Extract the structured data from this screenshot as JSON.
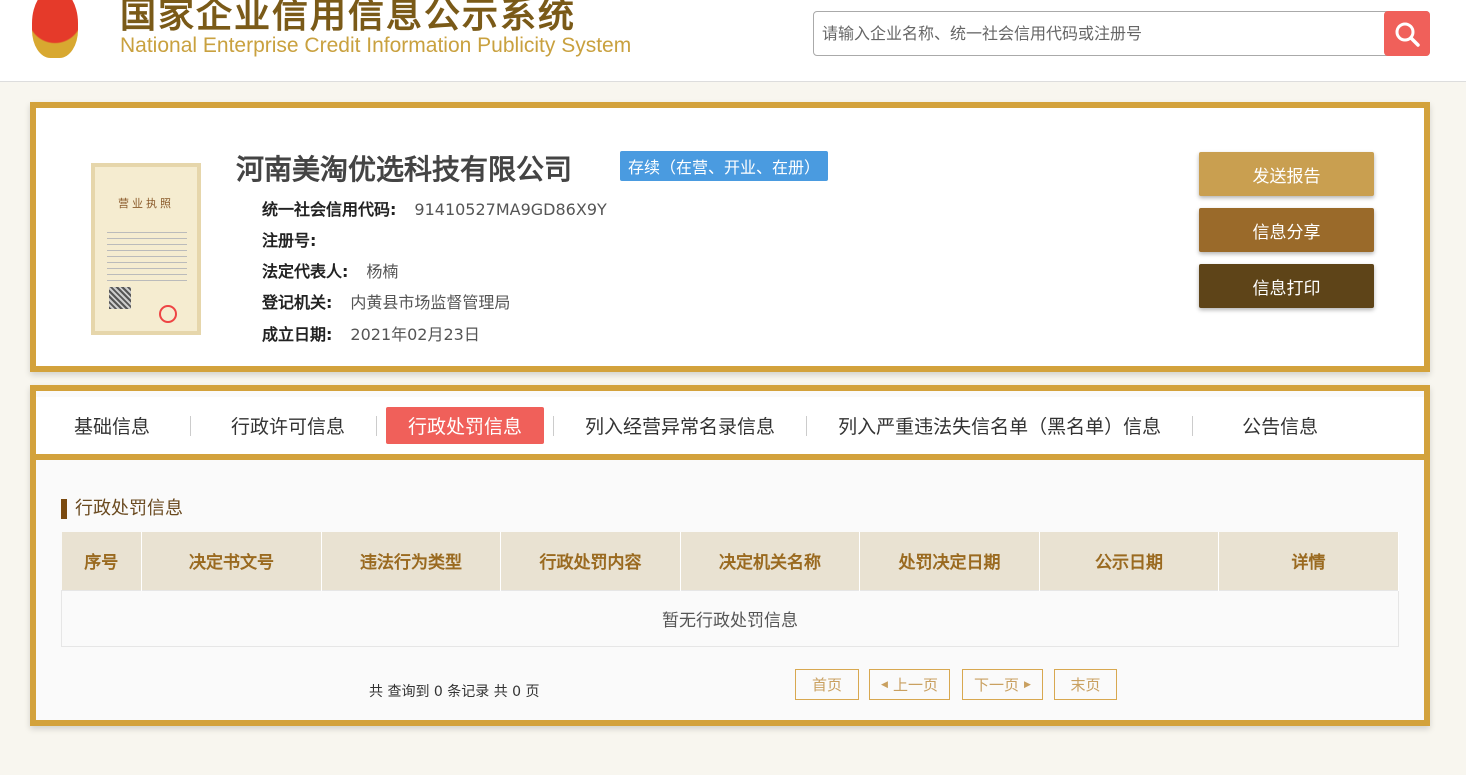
{
  "header": {
    "title_cn": "国家企业信用信息公示系统",
    "title_en": "National Enterprise Credit Information Publicity System",
    "search_placeholder": "请输入企业名称、统一社会信用代码或注册号"
  },
  "company": {
    "name": "河南美淘优选科技有限公司",
    "status": "存续（在营、开业、在册）",
    "license_title": "营业执照",
    "fields": [
      {
        "label": "统一社会信用代码:",
        "value": "91410527MA9GD86X9Y"
      },
      {
        "label": "注册号:",
        "value": ""
      },
      {
        "label": "法定代表人:",
        "value": "杨楠"
      },
      {
        "label": "登记机关:",
        "value": "内黄县市场监督管理局"
      },
      {
        "label": "成立日期:",
        "value": "2021年02月23日"
      }
    ]
  },
  "actions": {
    "send": "发送报告",
    "share": "信息分享",
    "print": "信息打印",
    "colors": [
      "#c99f50",
      "#9a6a2a",
      "#5e4418"
    ]
  },
  "tabs": [
    "基础信息",
    "行政许可信息",
    "行政处罚信息",
    "列入经营异常名录信息",
    "列入严重违法失信名单（黑名单）信息",
    "公告信息"
  ],
  "section": {
    "title": "行政处罚信息",
    "columns": [
      "序号",
      "决定书文号",
      "违法行为类型",
      "行政处罚内容",
      "决定机关名称",
      "处罚决定日期",
      "公示日期",
      "详情"
    ],
    "empty": "暂无行政处罚信息"
  },
  "pagination": {
    "summary": "共 查询到 0 条记录 共 0 页",
    "first": "首页",
    "prev": "上一页",
    "next": "下一页",
    "last": "末页"
  }
}
